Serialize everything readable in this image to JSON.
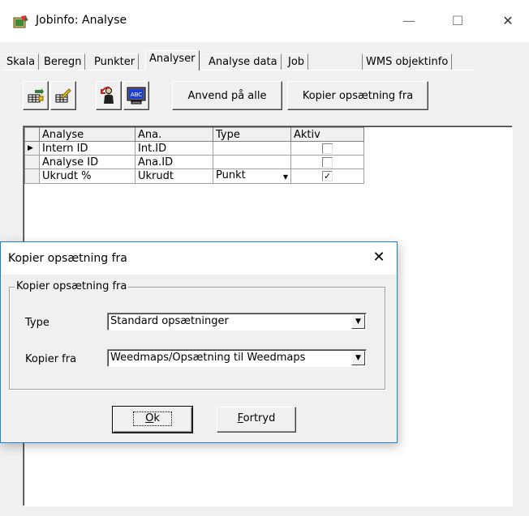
{
  "window": {
    "title": "Jobinfo: Analyse",
    "minimize_glyph": "—",
    "maximize_glyph": "☐",
    "close_glyph": "✕"
  },
  "tabs": [
    {
      "label": "Skala",
      "active": false
    },
    {
      "label": "Beregn",
      "active": false
    },
    {
      "label": "Punkter",
      "active": false
    },
    {
      "label": "Analyser",
      "active": true
    },
    {
      "label": "Analyse data",
      "active": false
    },
    {
      "label": "Job",
      "active": false
    },
    {
      "label": "WMS objektinfo",
      "active": false
    }
  ],
  "toolbar": {
    "icons": [
      "add-grid-icon",
      "edit-grid-icon",
      "user-import-icon",
      "monitor-abc-icon"
    ],
    "apply_all_label": "Anvend på alle",
    "copy_setup_label": "Kopier opsætning fra"
  },
  "grid": {
    "columns": [
      "Analyse",
      "Ana.",
      "Type",
      "Aktiv"
    ],
    "rows": [
      {
        "analyse": "Intern ID",
        "ana": "Int.ID",
        "type": "",
        "aktiv": false,
        "current": true
      },
      {
        "analyse": "Analyse ID",
        "ana": "Ana.ID",
        "type": "",
        "aktiv": false,
        "current": false
      },
      {
        "analyse": "Ukrudt %",
        "ana": "Ukrudt",
        "type": "Punkt",
        "aktiv": true,
        "current": false
      }
    ]
  },
  "dialog": {
    "title": "Kopier opsætning fra",
    "group_label": "Kopier opsætning fra",
    "type_label": "Type",
    "type_value": "Standard opsætninger",
    "copy_from_label": "Kopier fra",
    "copy_from_value": "Weedmaps/Opsætning til Weedmaps",
    "ok_mnemonic": "O",
    "ok_rest": "k",
    "cancel_mnemonic": "F",
    "cancel_rest": "ortryd",
    "close_glyph": "✕"
  },
  "colors": {
    "face": "#f0f0f0",
    "accent_border": "#1883d7"
  }
}
